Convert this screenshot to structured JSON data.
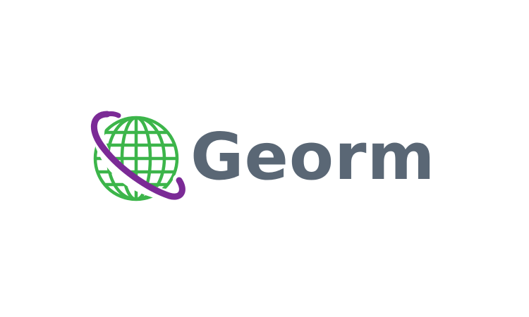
{
  "brand": {
    "name": "Georm",
    "text_color": "#5a6775",
    "globe_color": "#3cb54a",
    "ring_color": "#7b2a96",
    "icon": "globe-with-orbit-ring-icon"
  }
}
